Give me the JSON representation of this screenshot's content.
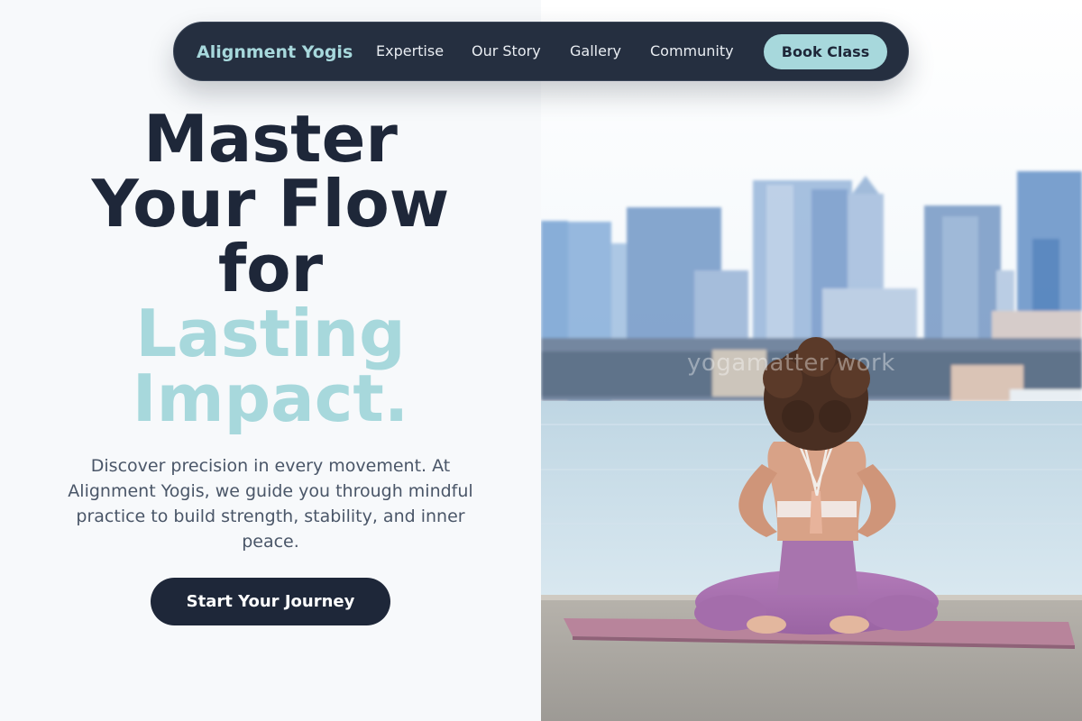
{
  "nav": {
    "brand": "Alignment Yogis",
    "links": [
      "Expertise",
      "Our Story",
      "Gallery",
      "Community"
    ],
    "book_label": "Book Class"
  },
  "hero": {
    "headline_lines": [
      "Master",
      "Your Flow",
      "for"
    ],
    "headline_accent_lines": [
      "Lasting",
      "Impact."
    ],
    "lede": "Discover precision in every movement. At Alignment Yogis, we guide you through mindful practice to build strength, stability, and inner peace.",
    "cta_label": "Start Your Journey"
  },
  "photo": {
    "subject": "woman in reverse prayer pose on mat by waterfront city skyline",
    "watermark": "yogamatter work"
  },
  "colors": {
    "navy": "#1e2739",
    "accent": "#a7d8dc",
    "background": "#f7f9fb",
    "body_text": "#4a5668"
  }
}
